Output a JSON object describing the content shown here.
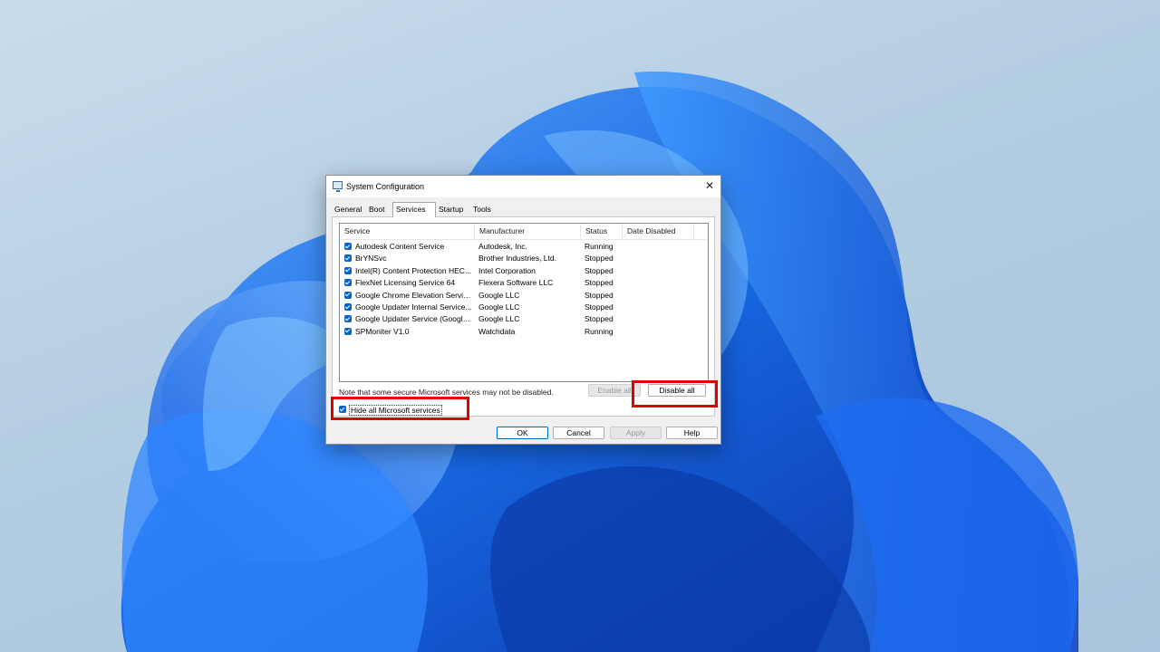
{
  "window": {
    "title": "System Configuration",
    "close_glyph": "✕",
    "icon": "msconfig-icon"
  },
  "tabs": [
    {
      "label": "General",
      "active": false
    },
    {
      "label": "Boot",
      "active": false
    },
    {
      "label": "Services",
      "active": true
    },
    {
      "label": "Startup",
      "active": false
    },
    {
      "label": "Tools",
      "active": false
    }
  ],
  "services": {
    "columns": [
      "Service",
      "Manufacturer",
      "Status",
      "Date Disabled"
    ],
    "rows": [
      {
        "name": "Autodesk Content Service",
        "manufacturer": "Autodesk, Inc.",
        "status": "Running",
        "date_disabled": "",
        "checked": true
      },
      {
        "name": "BrYNSvc",
        "manufacturer": "Brother Industries, Ltd.",
        "status": "Stopped",
        "date_disabled": "",
        "checked": true
      },
      {
        "name": "Intel(R) Content Protection HEC...",
        "manufacturer": "Intel Corporation",
        "status": "Stopped",
        "date_disabled": "",
        "checked": true
      },
      {
        "name": "FlexNet Licensing Service 64",
        "manufacturer": "Flexera Software LLC",
        "status": "Stopped",
        "date_disabled": "",
        "checked": true
      },
      {
        "name": "Google Chrome Elevation Servic...",
        "manufacturer": "Google LLC",
        "status": "Stopped",
        "date_disabled": "",
        "checked": true
      },
      {
        "name": "Google Updater Internal Service...",
        "manufacturer": "Google LLC",
        "status": "Stopped",
        "date_disabled": "",
        "checked": true
      },
      {
        "name": "Google Updater Service (Google...",
        "manufacturer": "Google LLC",
        "status": "Stopped",
        "date_disabled": "",
        "checked": true
      },
      {
        "name": "SPMoniter V1.0",
        "manufacturer": "Watchdata",
        "status": "Running",
        "date_disabled": "",
        "checked": true
      }
    ],
    "note": "Note that some secure Microsoft services may not be disabled.",
    "enable_all": "Enable all",
    "disable_all": "Disable all",
    "hide_ms_label": "Hide all Microsoft services",
    "hide_ms_checked": true
  },
  "footer": {
    "ok": "OK",
    "cancel": "Cancel",
    "apply": "Apply",
    "help": "Help"
  },
  "colors": {
    "highlight": "#e00000",
    "checkbox": "#0a64c8",
    "wallpaper_bloom": "#1a6ee8"
  }
}
